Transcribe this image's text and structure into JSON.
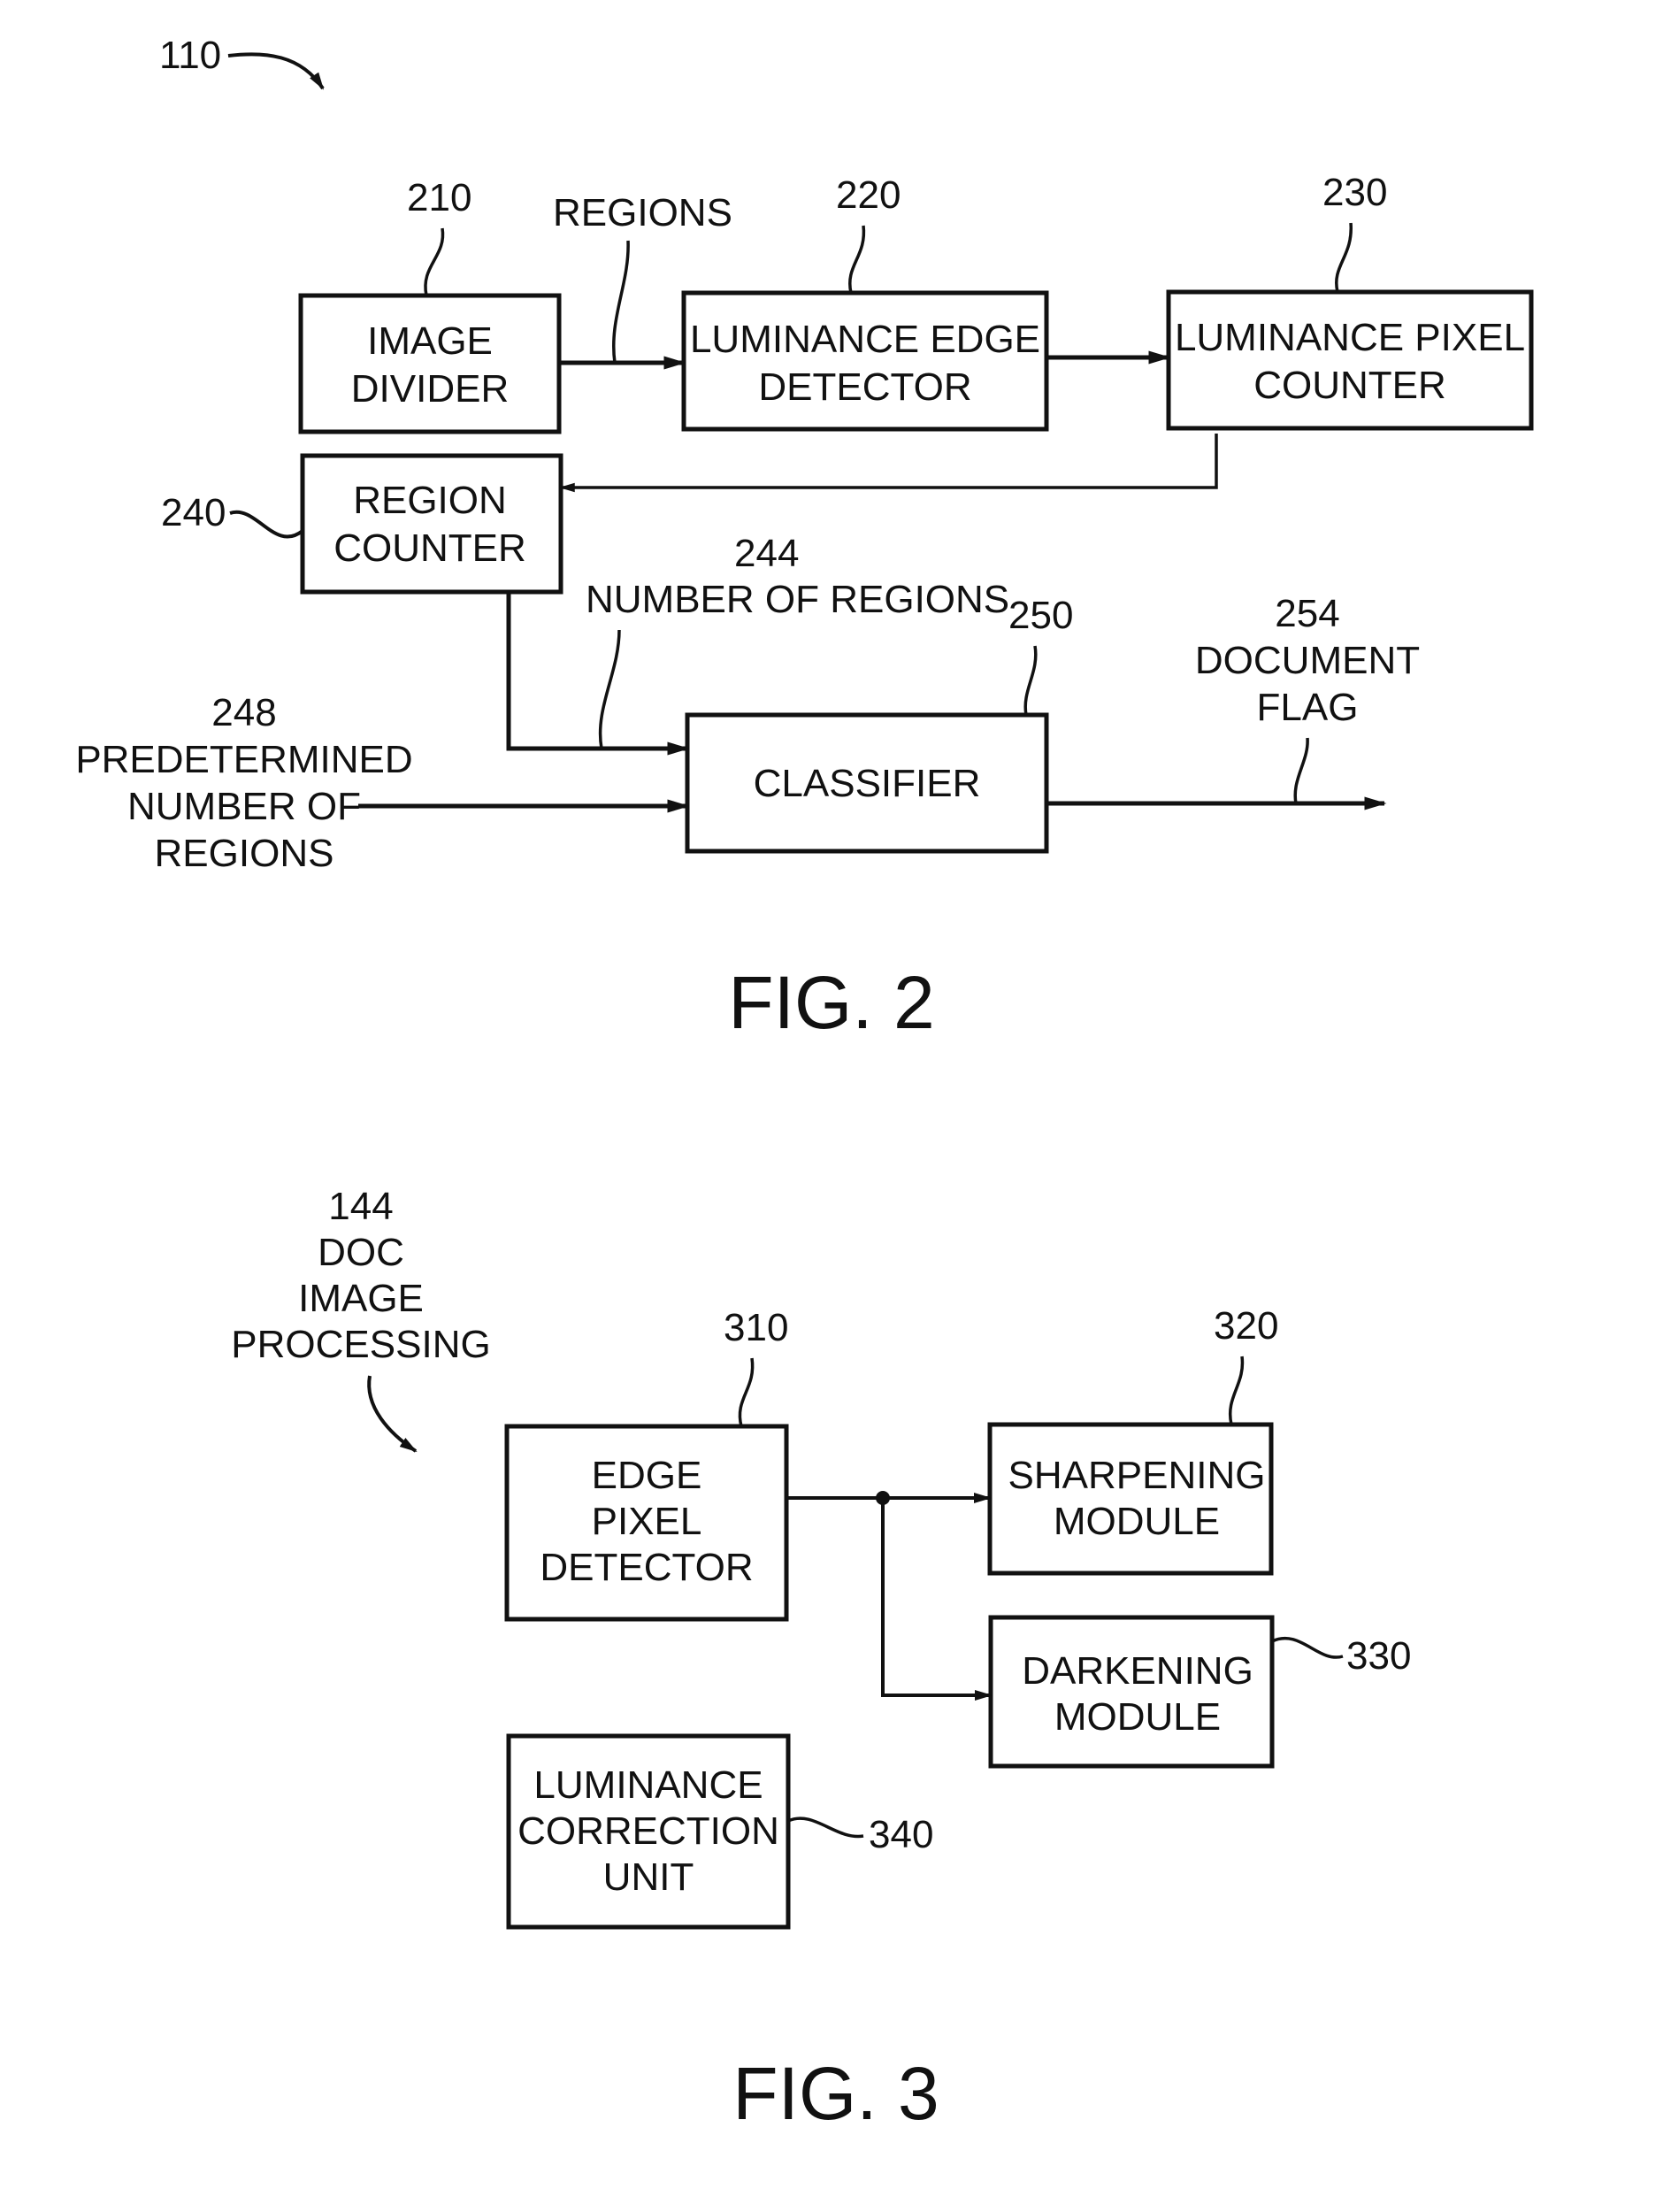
{
  "fig2": {
    "caption": "FIG. 2",
    "system_ref": "110",
    "blocks": [
      {
        "id": "210",
        "lines": [
          "IMAGE",
          "DIVIDER"
        ]
      },
      {
        "id": "220",
        "lines": [
          "LUMINANCE EDGE",
          "DETECTOR"
        ]
      },
      {
        "id": "230",
        "lines": [
          "LUMINANCE PIXEL",
          "COUNTER"
        ]
      },
      {
        "id": "240",
        "lines": [
          "REGION",
          "COUNTER"
        ]
      },
      {
        "id": "250",
        "lines": [
          "CLASSIFIER"
        ]
      }
    ],
    "signals": {
      "regions": "REGIONS",
      "num_regions_ref": "244",
      "num_regions": "NUMBER OF REGIONS",
      "predetermined_ref": "248",
      "predetermined": [
        "PREDETERMINED",
        "NUMBER OF",
        "REGIONS"
      ],
      "doc_flag_ref": "254",
      "doc_flag": [
        "DOCUMENT",
        "FLAG"
      ]
    }
  },
  "fig3": {
    "caption": "FIG. 3",
    "system_ref": "144",
    "system_label": [
      "DOC",
      "IMAGE",
      "PROCESSING"
    ],
    "blocks": [
      {
        "id": "310",
        "lines": [
          "EDGE",
          "PIXEL",
          "DETECTOR"
        ]
      },
      {
        "id": "320",
        "lines": [
          "SHARPENING",
          "MODULE"
        ]
      },
      {
        "id": "330",
        "lines": [
          "DARKENING",
          "MODULE"
        ]
      },
      {
        "id": "340",
        "lines": [
          "LUMINANCE",
          "CORRECTION",
          "UNIT"
        ]
      }
    ]
  }
}
